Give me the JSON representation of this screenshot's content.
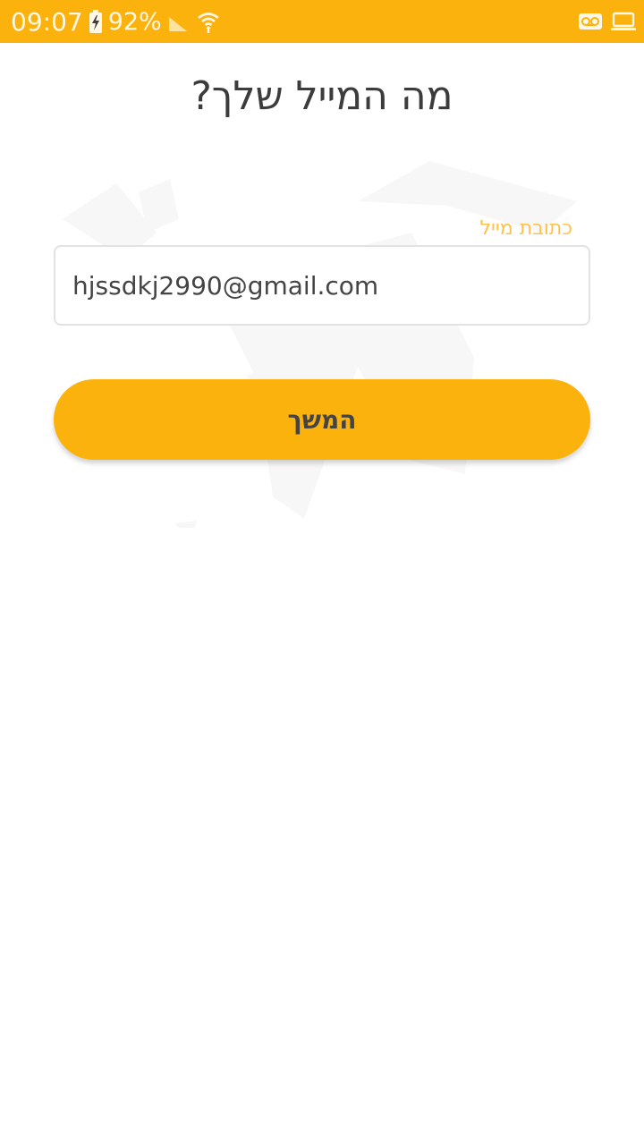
{
  "status_bar": {
    "time": "09:07",
    "battery_percent": "92%",
    "background_color": "#fcb20c",
    "icons": [
      "battery-charging-icon",
      "signal-icon",
      "wifi-icon",
      "voicemail-icon",
      "laptop-icon"
    ]
  },
  "page": {
    "title": "מה המייל שלך?"
  },
  "email": {
    "label": "כתובת מייל",
    "value": "hjssdkj2990@gmail.com"
  },
  "continue_button": {
    "label": "המשך",
    "color": "#fcb20c"
  }
}
